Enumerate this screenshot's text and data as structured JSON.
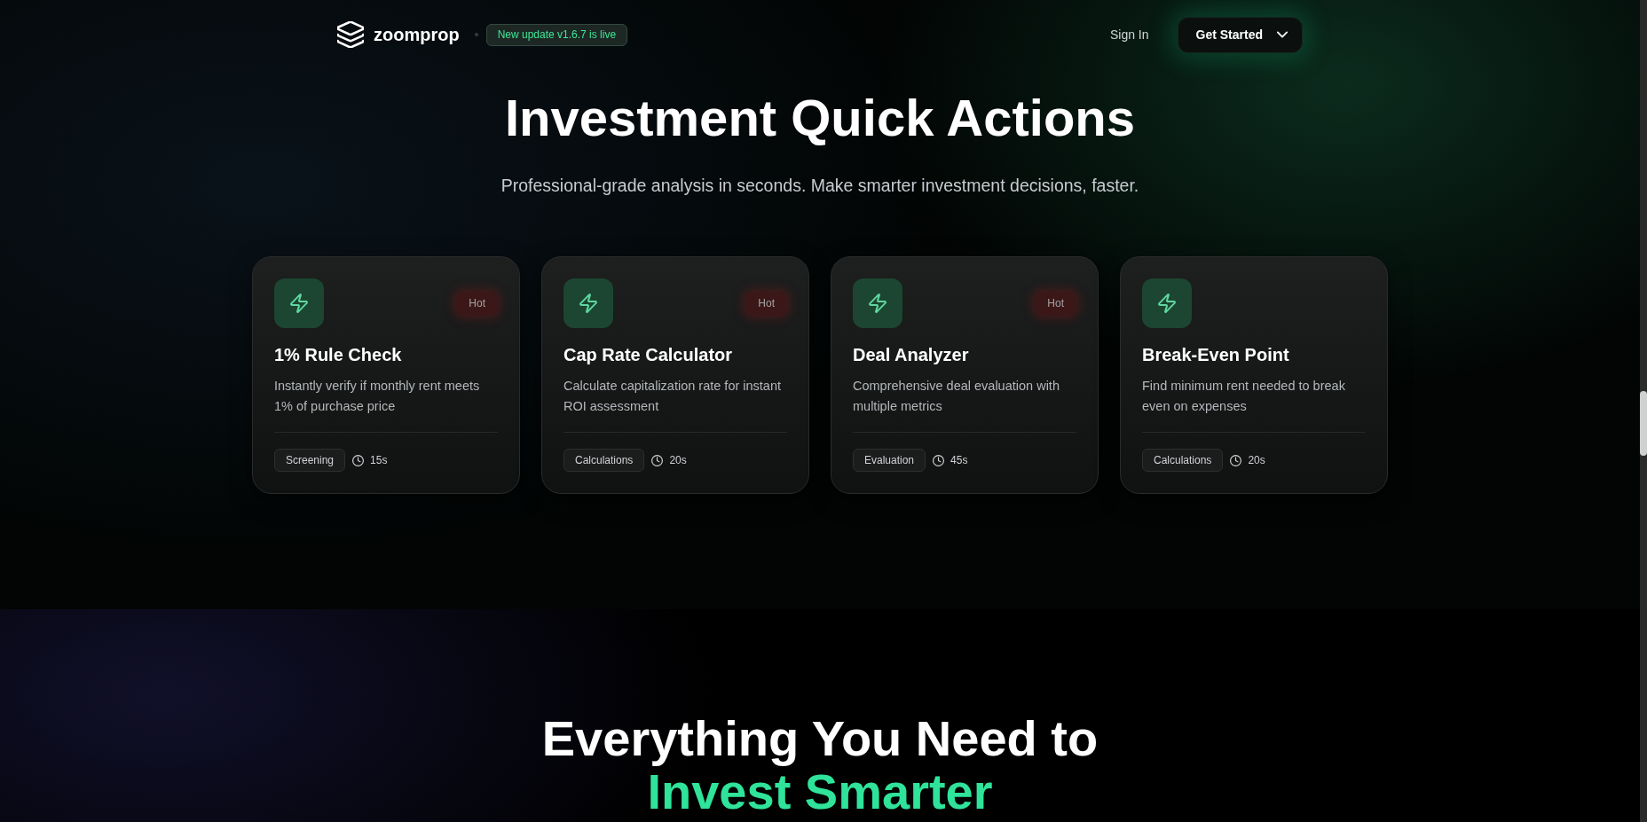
{
  "header": {
    "brand": "zoomprop",
    "update_badge": "New update v1.6.7 is live",
    "sign_in": "Sign In",
    "cta": "Get Started"
  },
  "quick_actions": {
    "title": "Investment Quick Actions",
    "subtitle": "Professional-grade analysis in seconds. Make smarter investment decisions, faster.",
    "cards": [
      {
        "badge": "Hot",
        "title": "1% Rule Check",
        "description": "Instantly verify if monthly rent meets 1% of purchase price",
        "category": "Screening",
        "duration": "15s"
      },
      {
        "badge": "Hot",
        "title": "Cap Rate Calculator",
        "description": "Calculate capitalization rate for instant ROI assessment",
        "category": "Calculations",
        "duration": "20s"
      },
      {
        "badge": "Hot",
        "title": "Deal Analyzer",
        "description": "Comprehensive deal evaluation with multiple metrics",
        "category": "Evaluation",
        "duration": "45s"
      },
      {
        "title": "Break-Even Point",
        "description": "Find minimum rent needed to break even on expenses",
        "category": "Calculations",
        "duration": "20s"
      }
    ]
  },
  "features": {
    "title": "Everything You Need to",
    "highlight": "Invest Smarter"
  }
}
